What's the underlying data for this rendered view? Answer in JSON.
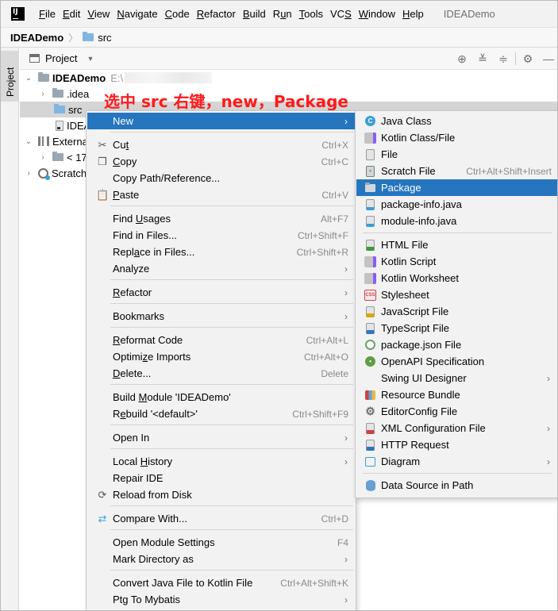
{
  "menubar": {
    "items": [
      {
        "pre": "",
        "u": "F",
        "post": "ile"
      },
      {
        "pre": "",
        "u": "E",
        "post": "dit"
      },
      {
        "pre": "",
        "u": "V",
        "post": "iew"
      },
      {
        "pre": "",
        "u": "N",
        "post": "avigate"
      },
      {
        "pre": "",
        "u": "C",
        "post": "ode"
      },
      {
        "pre": "",
        "u": "R",
        "post": "efactor"
      },
      {
        "pre": "",
        "u": "B",
        "post": "uild"
      },
      {
        "pre": "R",
        "u": "u",
        "post": "n"
      },
      {
        "pre": "",
        "u": "T",
        "post": "ools"
      },
      {
        "pre": "VC",
        "u": "S",
        "post": ""
      },
      {
        "pre": "",
        "u": "W",
        "post": "indow"
      },
      {
        "pre": "",
        "u": "H",
        "post": "elp"
      }
    ],
    "window_title": "IDEADemo"
  },
  "navbar": {
    "project": "IDEADemo",
    "sep": "〉",
    "folder": "src"
  },
  "sidestrip": {
    "tab_label": "Project"
  },
  "panel": {
    "title": "Project",
    "dropdown": "▼"
  },
  "tree": {
    "root": "IDEADemo",
    "root_path": "E:\\",
    "idea": ".idea",
    "src": "src",
    "iml": "IDEA",
    "external": "External",
    "jdk": "< 17",
    "scratches": "Scratch"
  },
  "annotation": "选中 src 右键，new，Package",
  "context_menu": {
    "new": {
      "label": "New"
    },
    "cut": {
      "u": "t",
      "pre": "Cu",
      "post": "",
      "shortcut": "Ctrl+X"
    },
    "copy": {
      "pre": "",
      "u": "C",
      "post": "opy",
      "shortcut": "Ctrl+C"
    },
    "copy_path": {
      "label": "Copy Path/Reference..."
    },
    "paste": {
      "pre": "",
      "u": "P",
      "post": "aste",
      "shortcut": "Ctrl+V"
    },
    "find_usages": {
      "pre": "Find ",
      "u": "U",
      "post": "sages",
      "shortcut": "Alt+F7"
    },
    "find_in_files": {
      "label": "Find in Files...",
      "shortcut": "Ctrl+Shift+F"
    },
    "replace_in_files": {
      "pre": "Repl",
      "u": "a",
      "post": "ce in Files...",
      "shortcut": "Ctrl+Shift+R"
    },
    "analyze": {
      "label": "Analyze"
    },
    "refactor": {
      "pre": "",
      "u": "R",
      "post": "efactor"
    },
    "bookmarks": {
      "label": "Bookmarks"
    },
    "reformat": {
      "pre": "",
      "u": "R",
      "post": "eformat Code",
      "shortcut": "Ctrl+Alt+L"
    },
    "optimize": {
      "pre": "Optimi",
      "u": "z",
      "post": "e Imports",
      "shortcut": "Ctrl+Alt+O"
    },
    "delete": {
      "pre": "",
      "u": "D",
      "post": "elete...",
      "shortcut": "Delete"
    },
    "build_module": {
      "pre": "Build ",
      "u": "M",
      "post": "odule 'IDEADemo'"
    },
    "rebuild": {
      "pre": "R",
      "u": "e",
      "post": "build '<default>'",
      "shortcut": "Ctrl+Shift+F9"
    },
    "open_in": {
      "label": "Open In"
    },
    "local_history": {
      "pre": "Local ",
      "u": "H",
      "post": "istory"
    },
    "repair_ide": {
      "label": "Repair IDE"
    },
    "reload": {
      "label": "Reload from Disk"
    },
    "compare": {
      "label": "Compare With...",
      "shortcut": "Ctrl+D"
    },
    "module_settings": {
      "label": "Open Module Settings",
      "shortcut": "F4"
    },
    "mark_dir": {
      "label": "Mark Directory as"
    },
    "convert": {
      "label": "Convert Java File to Kotlin File",
      "shortcut": "Ctrl+Alt+Shift+K"
    },
    "ptg": {
      "label": "Ptg To Mybatis"
    }
  },
  "submenu": {
    "java_class": "Java Class",
    "kotlin_class": "Kotlin Class/File",
    "file": "File",
    "scratch_file": "Scratch File",
    "scratch_shortcut": "Ctrl+Alt+Shift+Insert",
    "package": "Package",
    "package_info": "package-info.java",
    "module_info": "module-info.java",
    "html_file": "HTML File",
    "kotlin_script": "Kotlin Script",
    "kotlin_worksheet": "Kotlin Worksheet",
    "stylesheet": "Stylesheet",
    "js_file": "JavaScript File",
    "ts_file": "TypeScript File",
    "package_json": "package.json File",
    "openapi": "OpenAPI Specification",
    "swing": "Swing UI Designer",
    "resource_bundle": "Resource Bundle",
    "editorconfig": "EditorConfig File",
    "xml_config": "XML Configuration File",
    "http_request": "HTTP Request",
    "diagram": "Diagram",
    "data_source": "Data Source in Path"
  },
  "colors": {
    "highlight": "#2675bf",
    "annotation": "#ff1a1a",
    "menu_bg": "#f2f2f2"
  }
}
